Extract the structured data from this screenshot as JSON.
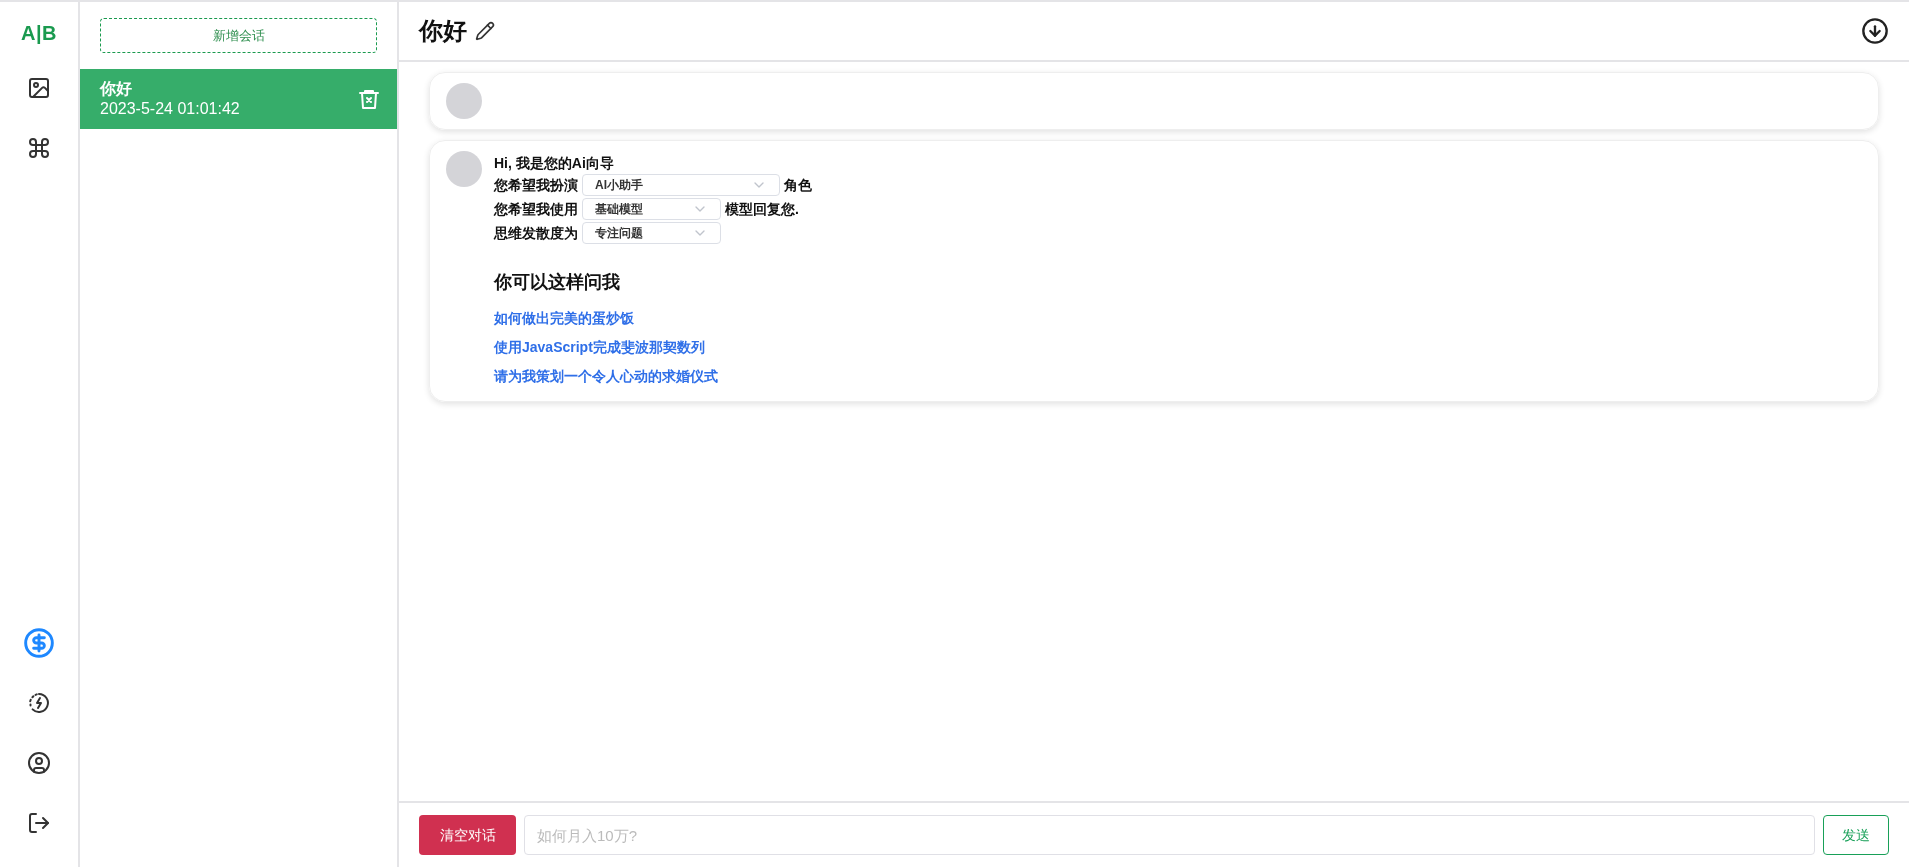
{
  "rail": {
    "logo": "A|B",
    "top_items": [
      {
        "kind": "image",
        "selected": false
      },
      {
        "kind": "plugin",
        "selected": false
      }
    ],
    "bottom_items": [
      {
        "kind": "dollar",
        "selected": true
      },
      {
        "kind": "energy",
        "selected": false
      },
      {
        "kind": "user",
        "selected": false
      },
      {
        "kind": "logout",
        "selected": false
      }
    ]
  },
  "sessions": {
    "new_button": "新增会话",
    "items": [
      {
        "title": "你好",
        "time": "2023-5-24 01:01:42",
        "selected": true
      }
    ]
  },
  "header": {
    "title": "你好"
  },
  "messages": [
    {
      "kind": "user"
    },
    {
      "kind": "intro",
      "greeting": "Hi, 我是您的Ai向导",
      "settings": [
        {
          "label": "您希望我扮演",
          "value": "AI小助手",
          "suffix": "角色",
          "wide": true
        },
        {
          "label": "您希望我使用",
          "value": "基础模型",
          "suffix": "模型回复您.",
          "wide": false
        },
        {
          "label": "思维发散度为",
          "value": "专注问题",
          "wide": false
        }
      ],
      "suggest_title": "你可以这样问我",
      "suggestions": [
        "如何做出完美的蛋炒饭",
        "使用JavaScript完成斐波那契数列",
        "请为我策划一个令人心动的求婚仪式"
      ]
    }
  ],
  "composer": {
    "clear_button": "清空对话",
    "placeholder": "如何月入10万?",
    "send_button": "发送"
  }
}
